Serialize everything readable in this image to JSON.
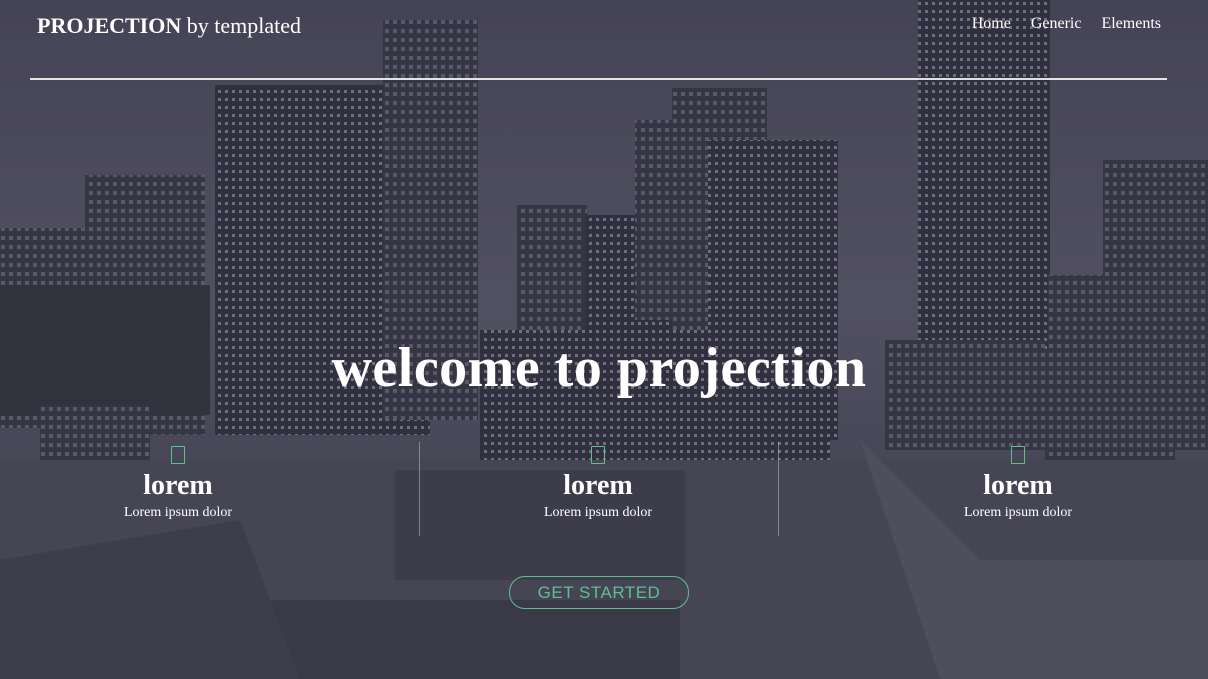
{
  "brand": {
    "name": "PROJECTION",
    "suffix": "by templated"
  },
  "nav": {
    "items": [
      "Home",
      "Generic",
      "Elements"
    ]
  },
  "hero": {
    "title": "welcome to projection"
  },
  "features": [
    {
      "icon": "square-outline-icon",
      "title": "lorem",
      "text": "Lorem ipsum dolor"
    },
    {
      "icon": "square-outline-icon",
      "title": "lorem",
      "text": "Lorem ipsum dolor"
    },
    {
      "icon": "square-outline-icon",
      "title": "lorem",
      "text": "Lorem ipsum dolor"
    }
  ],
  "cta": {
    "label": "GET STARTED"
  },
  "colors": {
    "accent": "#5fbf8f",
    "text": "#ffffff",
    "overlay": "#3c3a4e"
  }
}
